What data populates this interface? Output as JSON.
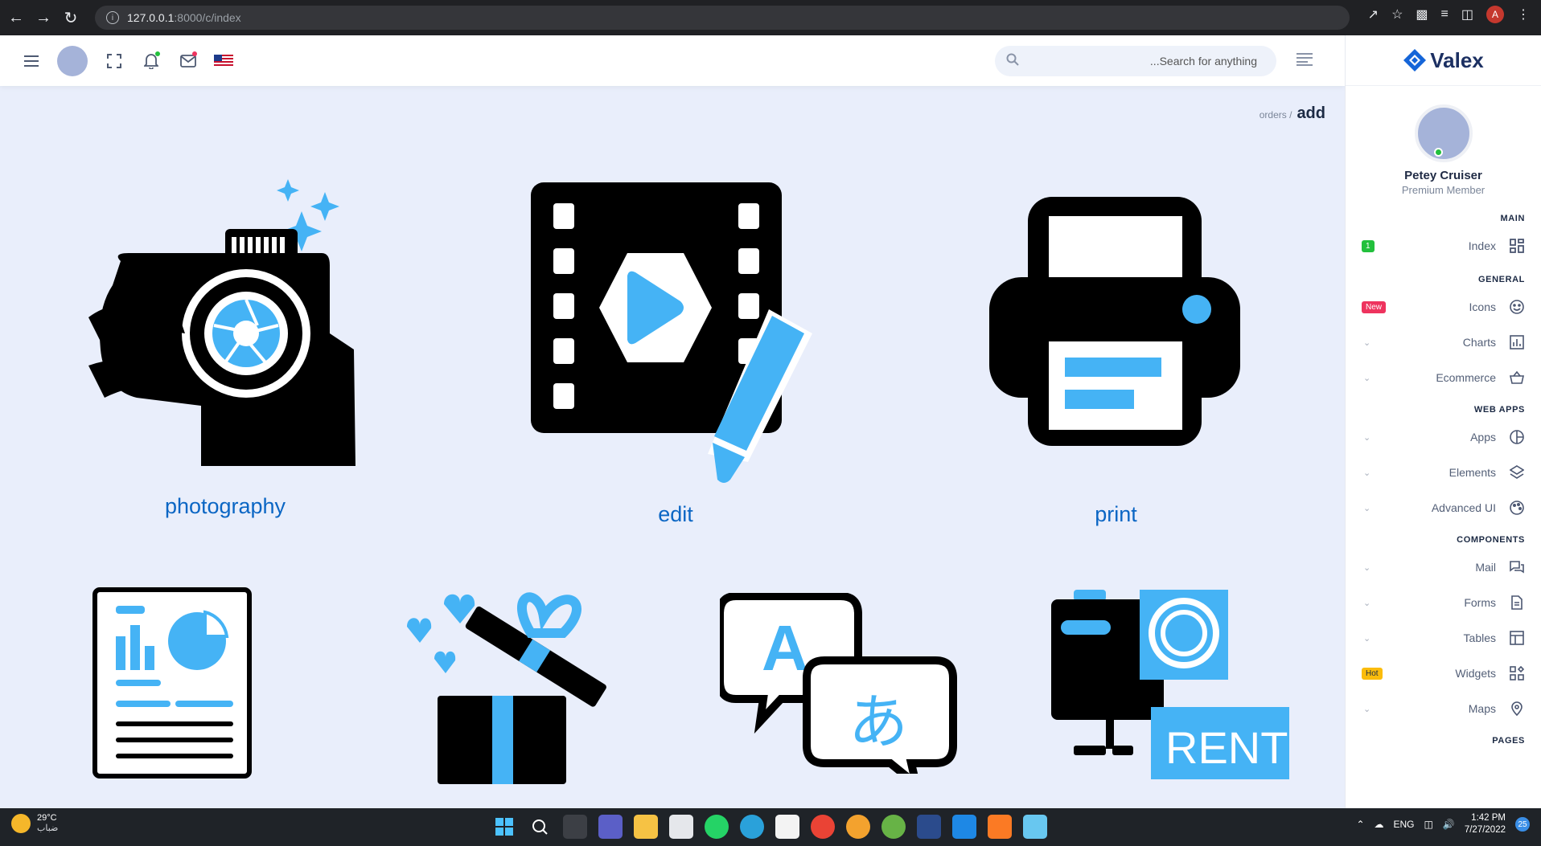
{
  "browser": {
    "url_host": "127.0.0.1",
    "url_path": ":8000/c/index",
    "profile_initial": "A"
  },
  "header": {
    "search_placeholder": "...Search for anything"
  },
  "sidebar": {
    "logo": "Valex",
    "user_name": "Petey Cruiser",
    "user_role": "Premium Member",
    "categories": {
      "main": "MAIN",
      "general": "GENERAL",
      "web_apps": "WEB APPS",
      "components": "COMPONENTS",
      "pages": "PAGES"
    },
    "items": {
      "index": {
        "label": "Index",
        "badge": "1"
      },
      "icons": {
        "label": "Icons",
        "badge": "New"
      },
      "charts": {
        "label": "Charts"
      },
      "ecommerce": {
        "label": "Ecommerce"
      },
      "apps": {
        "label": "Apps"
      },
      "elements": {
        "label": "Elements"
      },
      "advanced_ui": {
        "label": "Advanced UI"
      },
      "mail": {
        "label": "Mail"
      },
      "forms": {
        "label": "Forms"
      },
      "tables": {
        "label": "Tables"
      },
      "widgets": {
        "label": "Widgets",
        "badge": "Hot"
      },
      "maps": {
        "label": "Maps"
      }
    }
  },
  "breadcrumb": {
    "prev": "orders /",
    "current": "add"
  },
  "cards": {
    "photography": "photography",
    "edit": "edit",
    "print": "print",
    "rent_text": "RENT",
    "translate_a": "A",
    "translate_jp": "あ"
  },
  "taskbar": {
    "temperature": "29°C",
    "weather_desc": "ضباب",
    "language": "ENG",
    "time": "1:42 PM",
    "date": "7/27/2022",
    "notification_count": "25"
  },
  "colors": {
    "accent_blue": "#45b3f5",
    "caption_blue": "#0b66c4",
    "badge_green": "#22c03c",
    "badge_red": "#ee335e",
    "badge_yellow": "#fbbc0b"
  }
}
